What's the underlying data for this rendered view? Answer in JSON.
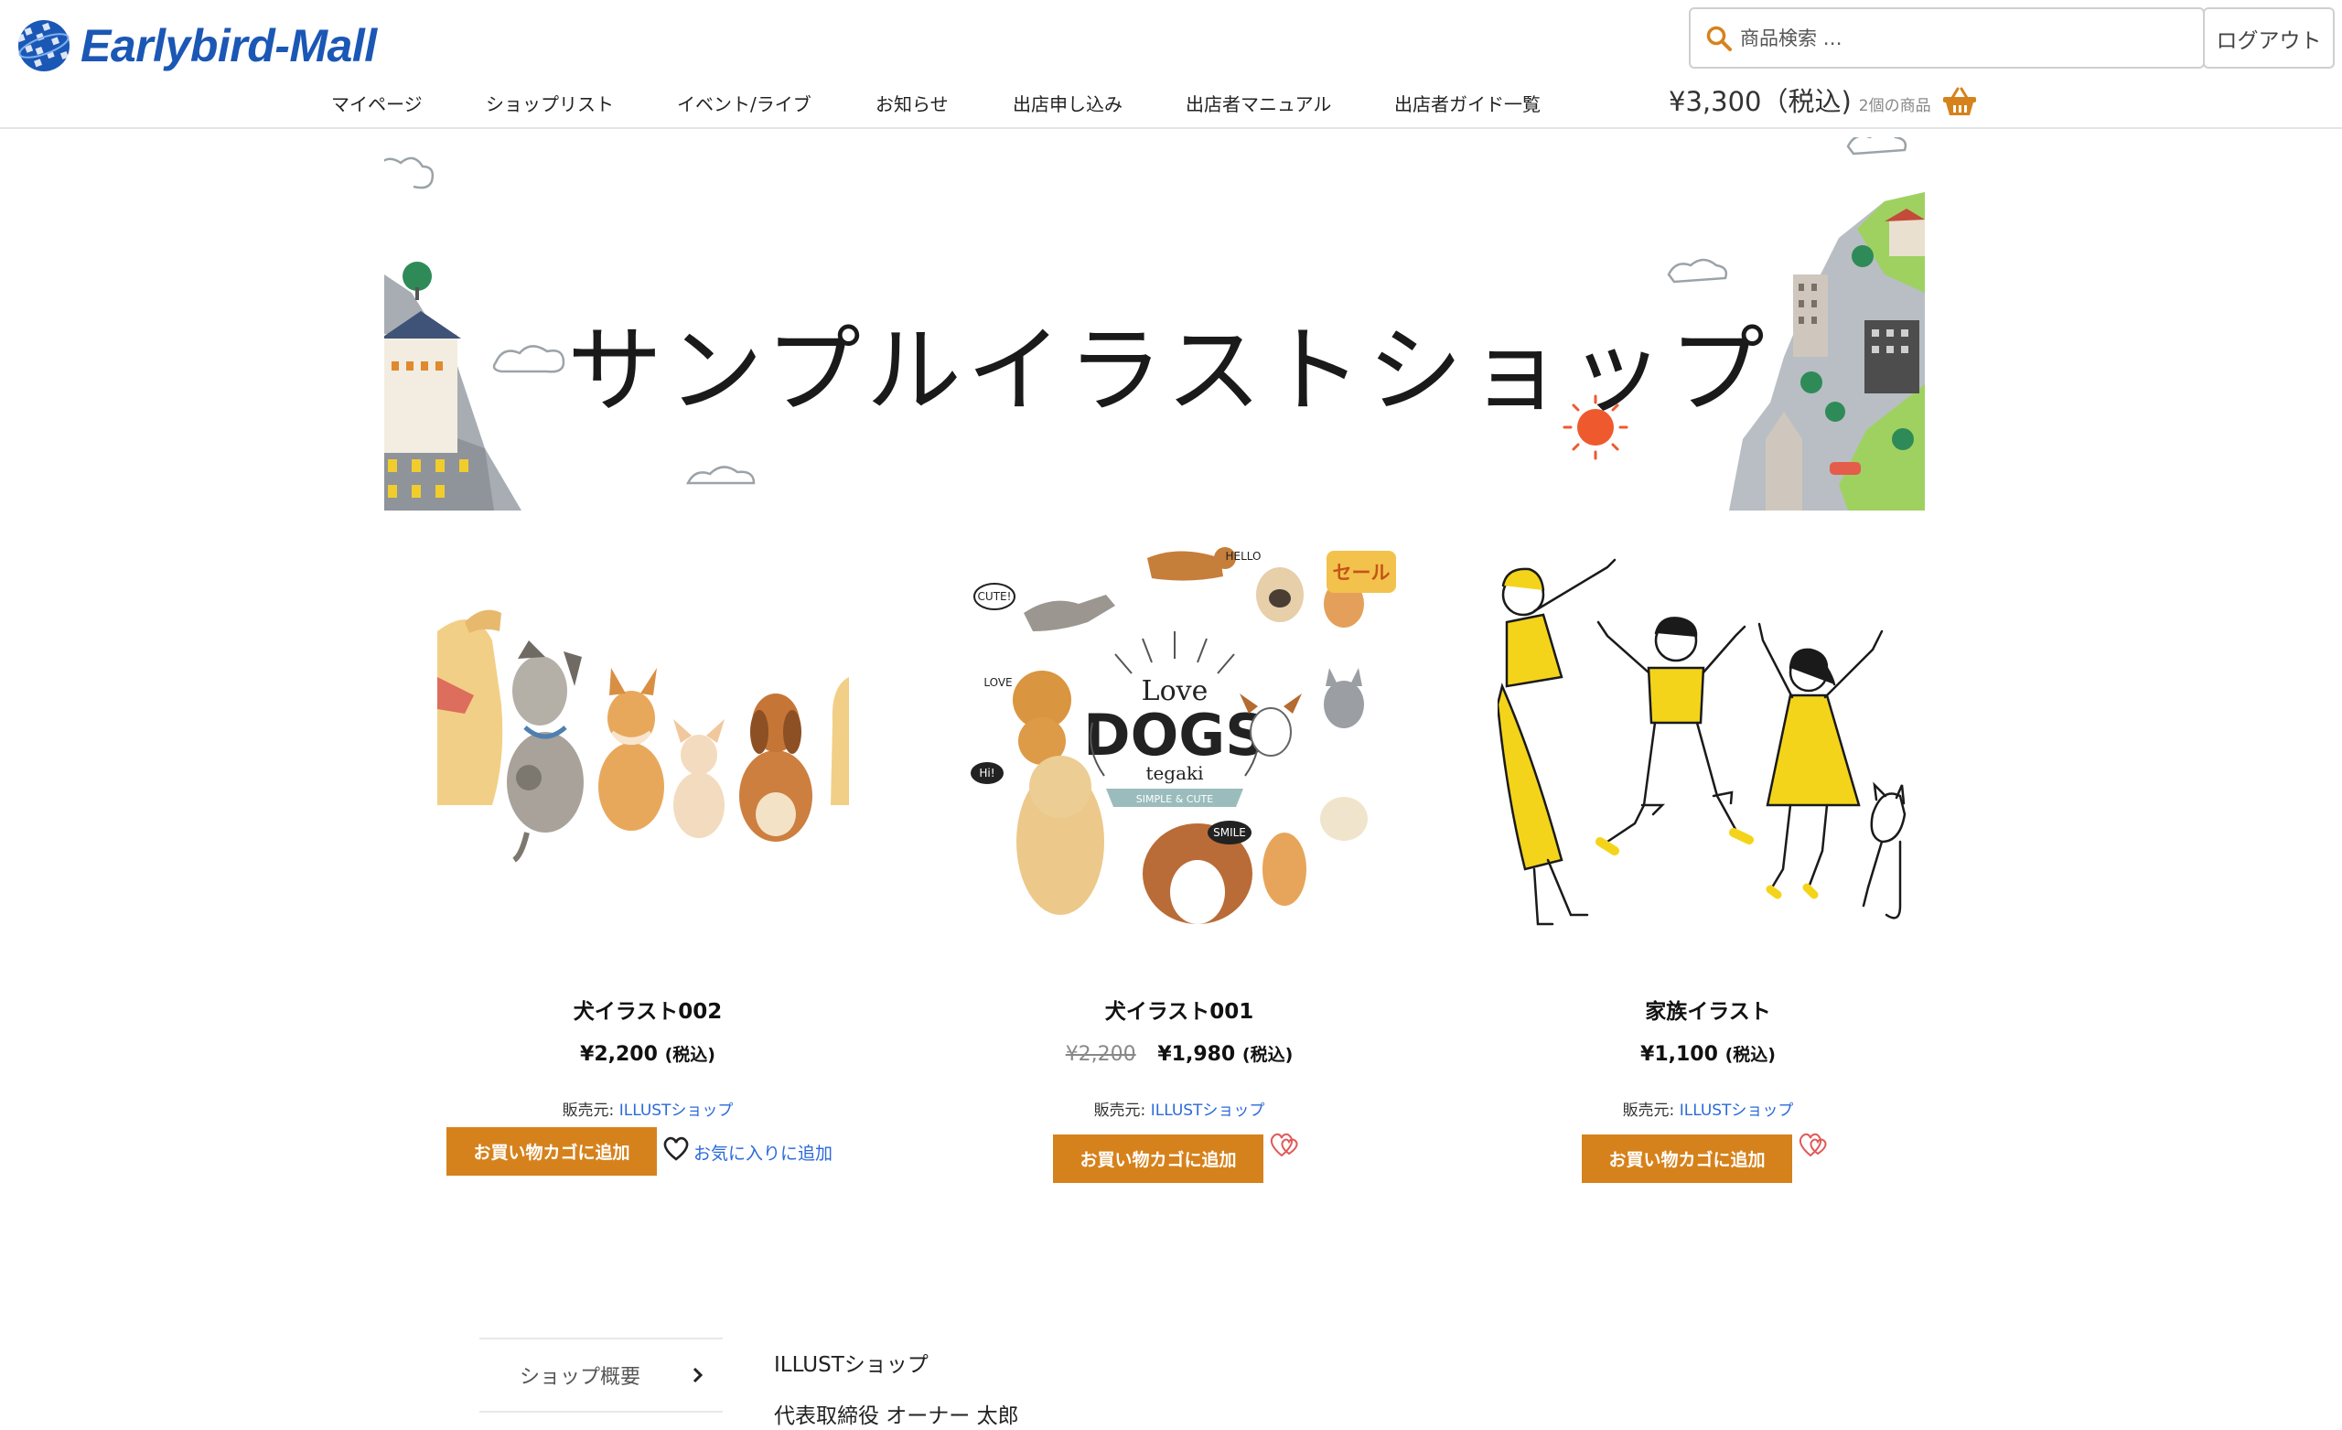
{
  "header": {
    "logo_text": "Earlybird-Mall",
    "search_placeholder": "商品検索 …",
    "logout_label": "ログアウト",
    "nav": [
      {
        "label": "マイページ"
      },
      {
        "label": "ショップリスト"
      },
      {
        "label": "イベント/ライブ"
      },
      {
        "label": "お知らせ"
      },
      {
        "label": "出店申し込み"
      },
      {
        "label": "出店者マニュアル"
      },
      {
        "label": "出店者ガイド一覧"
      }
    ],
    "cart_total": "¥3,300（税込)",
    "cart_count": "2個の商品",
    "colors": {
      "brand": "#1b57b5",
      "accent": "#d6821c",
      "link": "#2a6ad8"
    }
  },
  "banner": {
    "title": "サンプルイラストショップ"
  },
  "products": [
    {
      "name": "犬イラスト002",
      "price": "¥2,200",
      "old_price": "",
      "tax": "(税込)",
      "seller_label": "販売元:",
      "seller": "ILLUSTショップ",
      "cart_button": "お買い物カゴに追加",
      "favorite": "お気に入りに追加",
      "sale": ""
    },
    {
      "name": "犬イラスト001",
      "price": "¥1,980",
      "old_price": "¥2,200",
      "tax": "(税込)",
      "seller_label": "販売元:",
      "seller": "ILLUSTショップ",
      "cart_button": "お買い物カゴに追加",
      "favorite": "",
      "sale": "セール"
    },
    {
      "name": "家族イラスト",
      "price": "¥1,100",
      "old_price": "",
      "tax": "(税込)",
      "seller_label": "販売元:",
      "seller": "ILLUSTショップ",
      "cart_button": "お買い物カゴに追加",
      "favorite": "",
      "sale": ""
    }
  ],
  "dogs_art": {
    "love": "Love",
    "dogs": "DOGS",
    "tegaki": "tegaki",
    "ribbon": "SIMPLE & CUTE",
    "bubbles": [
      "HELLO",
      "CUTE!",
      "LOVE",
      "Hi!",
      "SMILE"
    ]
  },
  "shop_info": {
    "menu_label": "ショップ概要",
    "shop_name": "ILLUSTショップ",
    "representative": "代表取締役 オーナー 太郎"
  }
}
